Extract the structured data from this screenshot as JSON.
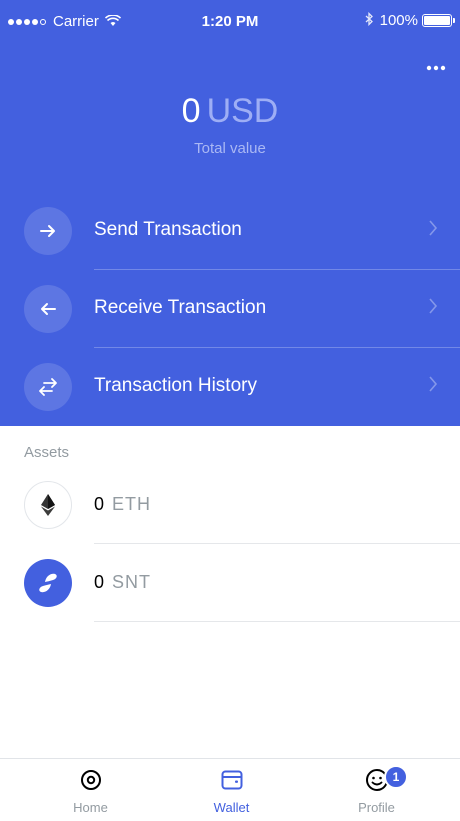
{
  "status_bar": {
    "carrier": "Carrier",
    "time": "1:20 PM",
    "battery": "100%"
  },
  "wallet": {
    "balance_amount": "0",
    "balance_currency": "USD",
    "balance_label": "Total value",
    "more_icon": "more-icon"
  },
  "actions": [
    {
      "label": "Send Transaction",
      "icon": "arrow-right-icon"
    },
    {
      "label": "Receive Transaction",
      "icon": "arrow-left-icon"
    },
    {
      "label": "Transaction History",
      "icon": "swap-arrows-icon"
    }
  ],
  "assets": {
    "heading": "Assets",
    "items": [
      {
        "amount": "0",
        "symbol": "ETH",
        "icon": "ethereum-icon"
      },
      {
        "amount": "0",
        "symbol": "SNT",
        "icon": "status-network-icon"
      }
    ]
  },
  "tabs": [
    {
      "label": "Home",
      "icon": "home-icon",
      "active": false
    },
    {
      "label": "Wallet",
      "icon": "wallet-icon",
      "active": true
    },
    {
      "label": "Profile",
      "icon": "profile-icon",
      "active": false,
      "badge": "1"
    }
  ],
  "colors": {
    "brand": "#4360df",
    "muted_text": "#939ba1"
  }
}
